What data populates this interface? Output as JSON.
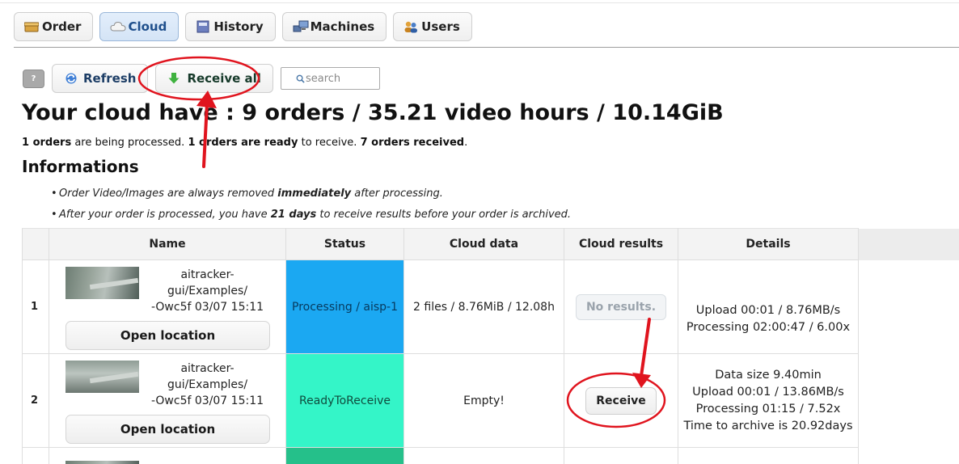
{
  "tabs": [
    {
      "label": "Order",
      "icon": "box-icon"
    },
    {
      "label": "Cloud",
      "icon": "cloud-icon",
      "active": true
    },
    {
      "label": "History",
      "icon": "book-icon"
    },
    {
      "label": "Machines",
      "icon": "computer-icon"
    },
    {
      "label": "Users",
      "icon": "users-icon"
    }
  ],
  "toolbar": {
    "help_label": "?",
    "refresh_label": "Refresh",
    "receive_all_label": "Receive all",
    "search_placeholder": "search"
  },
  "summary": {
    "title": "Your cloud have : 9 orders / 35.21 video hours / 10.14GiB",
    "processing_count": "1 orders",
    "processing_text": " are being processed. ",
    "ready_count": "1 orders are ready",
    "ready_text": " to receive. ",
    "received_count": "7 orders received",
    "received_text": "."
  },
  "informations": {
    "heading": "Informations",
    "item1_pre": "Order Video/Images are always removed ",
    "item1_bold": "immediately",
    "item1_post": " after processing.",
    "item2_pre": "After your order is processed, you have ",
    "item2_bold": "21 days",
    "item2_post": " to receive results before your order is archived."
  },
  "table": {
    "headers": {
      "name": "Name",
      "status": "Status",
      "cloud_data": "Cloud data",
      "cloud_results": "Cloud results",
      "details": "Details"
    },
    "open_location_label": "Open location",
    "rows": [
      {
        "num": "1",
        "path_line1": "aitracker-gui/Examples/",
        "path_line2": "-Owc5f 03/07 15:11",
        "status": "Processing / aisp-1",
        "cloud_data": "2 files / 8.76MiB / 12.08h",
        "results": "No results.",
        "details": [
          "Upload 00:01 / 8.76MB/s",
          "Processing 02:00:47 / 6.00x"
        ]
      },
      {
        "num": "2",
        "path_line1": "aitracker-gui/Examples/",
        "path_line2": "-Owc5f 03/07 15:11",
        "status": "ReadyToReceive",
        "cloud_data": "Empty!",
        "results": "Receive",
        "details": [
          "Data size 9.40min",
          "Upload 00:01 / 13.86MB/s",
          "Processing 01:15 / 7.52x",
          "Time to archive is 20.92days"
        ]
      }
    ]
  },
  "colors": {
    "processing": "#1ba8f2",
    "ready": "#34f5c8",
    "received": "#25c08a",
    "annotation": "#e0141e"
  }
}
